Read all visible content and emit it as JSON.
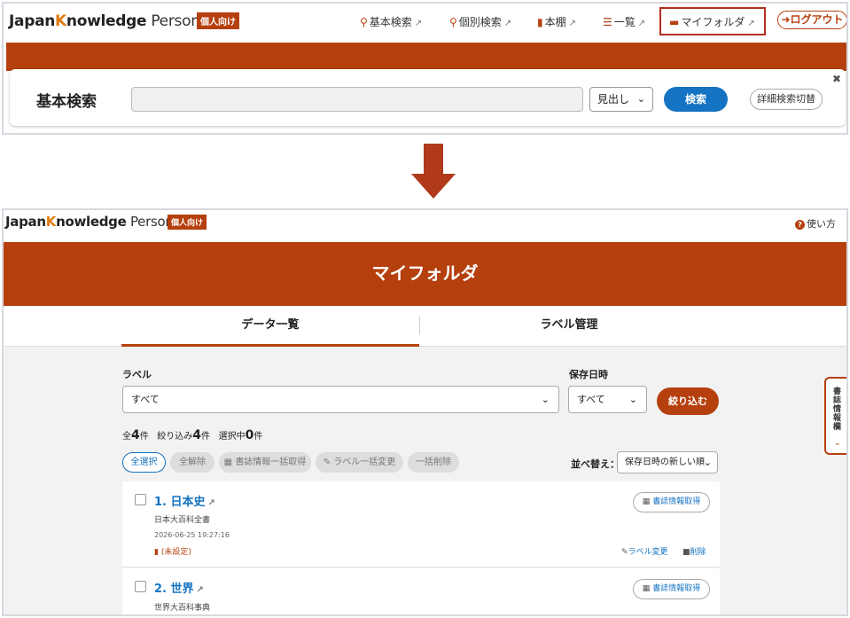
{
  "top": {
    "logo": {
      "japan": "Japan",
      "k": "K",
      "nowledge": "nowledge",
      "personal": " Personal"
    },
    "badge": "個人向け",
    "nav": [
      {
        "icon": "search-icon",
        "glyph": "🔍",
        "label": "基本検索"
      },
      {
        "icon": "search-plus-icon",
        "glyph": "🔎",
        "label": "個別検索"
      },
      {
        "icon": "book-icon",
        "glyph": "▇",
        "label": "本棚"
      },
      {
        "icon": "list-icon",
        "glyph": "☰",
        "label": "一覧"
      },
      {
        "icon": "folder-icon",
        "glyph": "▬",
        "label": "マイフォルダ"
      }
    ],
    "external_glyph": "↗",
    "logout": "ログアウト",
    "search_title": "基本検索",
    "search_placeholder": "",
    "search_mode": "見出し",
    "search_button": "検索",
    "advanced_toggle": "詳細検索切替"
  },
  "bottom": {
    "logo": {
      "japan": "Japan",
      "k": "K",
      "nowledge": "nowledge",
      "personal": " Personal"
    },
    "badge": "個人向け",
    "help": "使い方",
    "hero_title": "マイフォルダ",
    "tabs": [
      "データ一覧",
      "ラベル管理"
    ],
    "label_filter_label": "ラベル",
    "label_filter_value": "すべて",
    "date_filter_label": "保存日時",
    "date_filter_value": "すべて",
    "filter_button": "絞り込む",
    "counts": {
      "total_prefix": "全",
      "total": "4",
      "total_suffix": "件",
      "filtered_prefix": "絞り込み",
      "filtered": "4",
      "filtered_suffix": "件",
      "selected_prefix": "選択中",
      "selected": "0",
      "selected_suffix": "件"
    },
    "actions": [
      "全選択",
      "全解除",
      "書誌情報一括取得",
      "ラベル一括変更",
      "一括削除"
    ],
    "sort_label": "並べ替え：",
    "sort_value": "保存日時の新しい順",
    "items": [
      {
        "number": "1.",
        "title": "日本史",
        "source": "日本大百科全書",
        "date": "2026-06-25 19:27:16",
        "label": "(未設定)"
      },
      {
        "number": "2.",
        "title": "世界",
        "source": "世界大百科事典"
      }
    ],
    "biblio_button": "書誌情報取得",
    "label_change": "ラベル変更",
    "delete": "削除",
    "side_tab": "書誌情報欄"
  }
}
